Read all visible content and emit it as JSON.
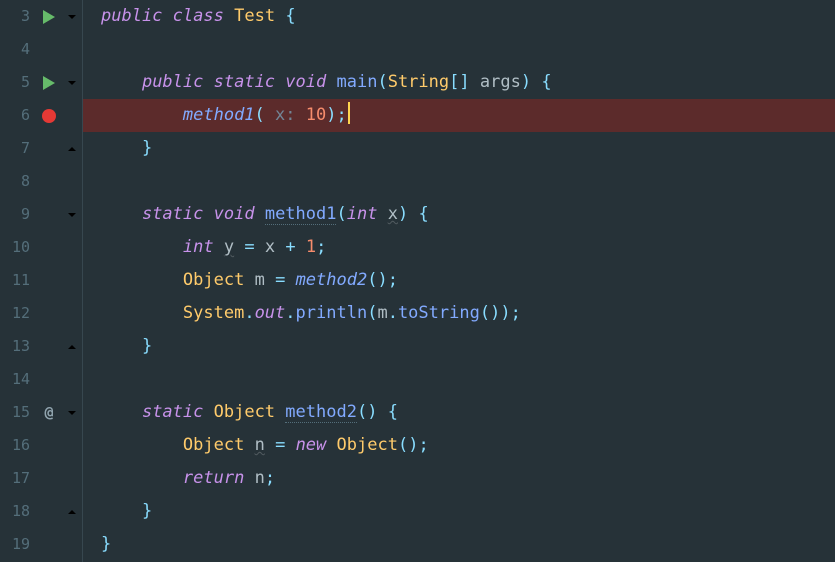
{
  "lines": [
    {
      "num": 3,
      "icon": "play",
      "fold": "down"
    },
    {
      "num": 4,
      "icon": null,
      "fold": null
    },
    {
      "num": 5,
      "icon": "play",
      "fold": "down"
    },
    {
      "num": 6,
      "icon": "bp",
      "fold": null
    },
    {
      "num": 7,
      "icon": null,
      "fold": "up"
    },
    {
      "num": 8,
      "icon": null,
      "fold": null
    },
    {
      "num": 9,
      "icon": null,
      "fold": "down"
    },
    {
      "num": 10,
      "icon": null,
      "fold": null
    },
    {
      "num": 11,
      "icon": null,
      "fold": null
    },
    {
      "num": 12,
      "icon": null,
      "fold": null
    },
    {
      "num": 13,
      "icon": null,
      "fold": "up"
    },
    {
      "num": 14,
      "icon": null,
      "fold": null
    },
    {
      "num": 15,
      "icon": "at",
      "fold": "down"
    },
    {
      "num": 16,
      "icon": null,
      "fold": null
    },
    {
      "num": 17,
      "icon": null,
      "fold": null
    },
    {
      "num": 18,
      "icon": null,
      "fold": "up"
    },
    {
      "num": 19,
      "icon": null,
      "fold": null
    }
  ],
  "tok": {
    "public": "public",
    "class": "class",
    "Test": "Test",
    "static": "static",
    "void": "void",
    "main": "main",
    "String": "String",
    "args": "args",
    "method1": "method1",
    "xhint": " x: ",
    "ten": "10",
    "int_kw": "int",
    "x": "x",
    "y": "y",
    "one": "1",
    "Object": "Object",
    "m": "m",
    "method2": "method2",
    "System": "System",
    "out": "out",
    "println": "println",
    "toString": "toString",
    "n": "n",
    "new": "new",
    "return": "return",
    "lbrace": "{",
    "rbrace": "}",
    "lparen": "(",
    "rparen": ")",
    "lbrack": "[",
    "rbrack": "]",
    "semi": ";",
    "dot": ".",
    "eq": "=",
    "plus": "+",
    "sp": " "
  },
  "colors": {
    "background": "#263238",
    "current_line": "#5c2b2b",
    "keyword": "#c792ea",
    "type": "#ffcb6b",
    "function": "#82aaff",
    "number": "#f78c6c",
    "punct": "#89ddff",
    "gutter": "#546e7a",
    "play": "#66bb6a",
    "breakpoint": "#e53935",
    "cursor": "#ffd54f"
  }
}
